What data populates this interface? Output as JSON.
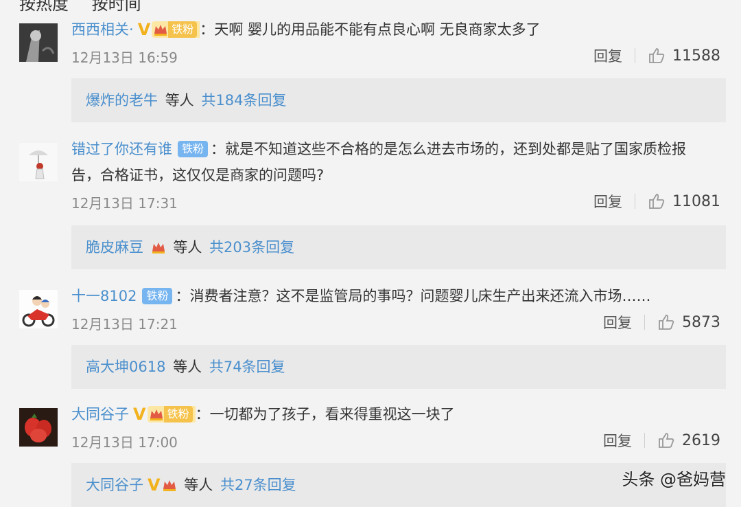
{
  "sort_tabs": [
    "按热度",
    "按时间"
  ],
  "comments": [
    {
      "user": "西西相关·",
      "verified": "V",
      "fan_badge": "铁粉",
      "sep": "：",
      "text": "天啊 婴儿的用品能不能有点良心啊 无良商家太多了",
      "text2": "",
      "time": "12月13日 16:59",
      "reply_label": "回复",
      "likes": "11588",
      "replies": {
        "name": "爆炸的老牛",
        "others": "等人",
        "count": "共184条回复"
      }
    },
    {
      "user": "错过了你还有谁",
      "fan_badge": "铁粉",
      "sep": "：",
      "text": "就是不知道这些不合格的是怎么进去市场的，还到处都是贴了国家质检报",
      "text2": "告，合格证书，这仅仅是商家的问题吗?",
      "time": "12月13日 17:31",
      "reply_label": "回复",
      "likes": "11081",
      "replies": {
        "name": "脆皮麻豆",
        "others": "等人",
        "count": "共203条回复"
      }
    },
    {
      "user": "十一8102",
      "fan_badge": "铁粉",
      "sep": "：",
      "text": "消费者注意？这不是监管局的事吗？问题婴儿床生产出来还流入市场……",
      "text2": "",
      "time": "12月13日 17:21",
      "reply_label": "回复",
      "likes": "5873",
      "replies": {
        "name": "高大坤0618",
        "others": "等人",
        "count": "共74条回复"
      }
    },
    {
      "user": "大同谷子",
      "verified": "V",
      "fan_badge": "铁粉",
      "sep": "：",
      "text": "一切都为了孩子，看来得重视这一块了",
      "text2": "",
      "time": "12月13日 17:00",
      "reply_label": "回复",
      "likes": "2619",
      "replies": {
        "name": "大同谷子",
        "verified": "V",
        "others": "等人",
        "count": "共27条回复"
      }
    }
  ],
  "watermark": "头条 @爸妈营",
  "colors": {
    "username": "#4a8fcd",
    "verified": "#f2b21d",
    "fan_badge": "#77b5f0",
    "reply_bg": "#e9e9e9"
  }
}
